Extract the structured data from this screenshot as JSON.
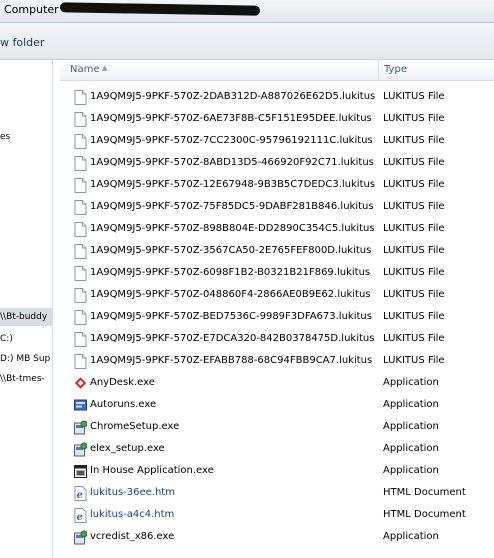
{
  "address": {
    "label": "Computer"
  },
  "toolbar": {
    "new_folder": "w folder"
  },
  "nav": [
    {
      "label": "es",
      "selected": false
    },
    {
      "label": "\\\\Bt-buddy",
      "selected": true
    },
    {
      "label": "C:)",
      "selected": false
    },
    {
      "label": "D:) MB Sup",
      "selected": false
    },
    {
      "label": "\\\\Bt-tmes-",
      "selected": false
    }
  ],
  "columns": {
    "name": "Name",
    "type": "Type"
  },
  "files": [
    {
      "name": "1A9QM9J5-9PKF-570Z-2DAB312D-A887026E62D5.lukitus",
      "type": "LUKITUS File",
      "icon": "blank-file-icon"
    },
    {
      "name": "1A9QM9J5-9PKF-570Z-6AE73F8B-C5F151E95DEE.lukitus",
      "type": "LUKITUS File",
      "icon": "blank-file-icon"
    },
    {
      "name": "1A9QM9J5-9PKF-570Z-7CC2300C-95796192111C.lukitus",
      "type": "LUKITUS File",
      "icon": "blank-file-icon"
    },
    {
      "name": "1A9QM9J5-9PKF-570Z-8ABD13D5-466920F92C71.lukitus",
      "type": "LUKITUS File",
      "icon": "blank-file-icon"
    },
    {
      "name": "1A9QM9J5-9PKF-570Z-12E67948-9B3B5C7DEDC3.lukitus",
      "type": "LUKITUS File",
      "icon": "blank-file-icon"
    },
    {
      "name": "1A9QM9J5-9PKF-570Z-75F85DC5-9DABF281B846.lukitus",
      "type": "LUKITUS File",
      "icon": "blank-file-icon"
    },
    {
      "name": "1A9QM9J5-9PKF-570Z-898B804E-DD2890C354C5.lukitus",
      "type": "LUKITUS File",
      "icon": "blank-file-icon"
    },
    {
      "name": "1A9QM9J5-9PKF-570Z-3567CA50-2E765FEF800D.lukitus",
      "type": "LUKITUS File",
      "icon": "blank-file-icon"
    },
    {
      "name": "1A9QM9J5-9PKF-570Z-6098F1B2-B0321B21F869.lukitus",
      "type": "LUKITUS File",
      "icon": "blank-file-icon"
    },
    {
      "name": "1A9QM9J5-9PKF-570Z-048860F4-2866AE0B9E62.lukitus",
      "type": "LUKITUS File",
      "icon": "blank-file-icon"
    },
    {
      "name": "1A9QM9J5-9PKF-570Z-BED7536C-9989F3DFA673.lukitus",
      "type": "LUKITUS File",
      "icon": "blank-file-icon"
    },
    {
      "name": "1A9QM9J5-9PKF-570Z-E7DCA320-842B0378475D.lukitus",
      "type": "LUKITUS File",
      "icon": "blank-file-icon"
    },
    {
      "name": "1A9QM9J5-9PKF-570Z-EFABB788-68C94FBB9CA7.lukitus",
      "type": "LUKITUS File",
      "icon": "blank-file-icon"
    },
    {
      "name": "AnyDesk.exe",
      "type": "Application",
      "icon": "anydesk-icon"
    },
    {
      "name": "Autoruns.exe",
      "type": "Application",
      "icon": "autoruns-icon"
    },
    {
      "name": "ChromeSetup.exe",
      "type": "Application",
      "icon": "setup-icon"
    },
    {
      "name": "elex_setup.exe",
      "type": "Application",
      "icon": "setup-icon"
    },
    {
      "name": "In House Application.exe",
      "type": "Application",
      "icon": "app-window-icon"
    },
    {
      "name": "lukitus-36ee.htm",
      "type": "HTML Document",
      "icon": "ie-document-icon"
    },
    {
      "name": "lukitus-a4c4.htm",
      "type": "HTML Document",
      "icon": "ie-document-icon"
    },
    {
      "name": "vcredist_x86.exe",
      "type": "Application",
      "icon": "setup-icon"
    }
  ],
  "colors": {
    "anydesk": "#d9221b",
    "html_link": "#1f3d8f",
    "selected_nav": "#dadde3"
  }
}
